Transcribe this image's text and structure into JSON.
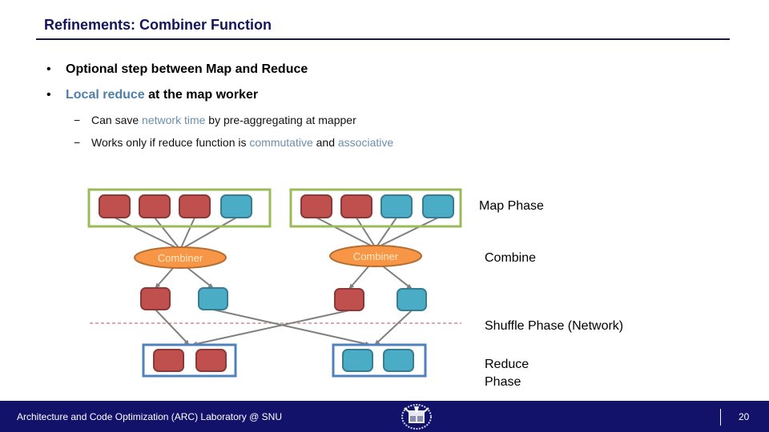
{
  "slide": {
    "title": "Refinements: Combiner Function",
    "bullets": [
      {
        "marker": "•",
        "parts": [
          {
            "text": "Optional  step  between  Map  and  Reduce",
            "highlight": false
          }
        ]
      },
      {
        "marker": "•",
        "parts": [
          {
            "text": "Local reduce",
            "highlight": true
          },
          {
            "text": " at the map worker",
            "highlight": false
          }
        ]
      }
    ],
    "sub_bullets": [
      {
        "marker": "−",
        "before": "Can save ",
        "highlight": "network time",
        "after": " by pre-aggregating at mapper"
      },
      {
        "marker": "−",
        "before": "Works only if reduce function is ",
        "highlight": "commutative",
        "middle": " and ",
        "highlight2": "associative"
      }
    ]
  },
  "diagram": {
    "colors": {
      "red_fill": "#c0504d",
      "red_stroke": "#8c3836",
      "blue_fill": "#4bacc6",
      "blue_stroke": "#357d91",
      "map_box_stroke": "#9bbb59",
      "reduce_box_stroke": "#4f81bd",
      "combiner_fill": "#f79646",
      "combiner_stroke": "#b66d31",
      "arrow": "#808080",
      "network_line": "#c0504d"
    },
    "map_workers": [
      {
        "records": [
          "red",
          "red",
          "red",
          "blue"
        ]
      },
      {
        "records": [
          "red",
          "red",
          "blue",
          "blue"
        ]
      }
    ],
    "combiners": [
      {
        "label": "Combiner",
        "outputs": [
          "red",
          "blue"
        ]
      },
      {
        "label": "Combiner",
        "outputs": [
          "red",
          "blue"
        ]
      }
    ],
    "reducers": [
      {
        "records": [
          "red",
          "red"
        ]
      },
      {
        "records": [
          "blue",
          "blue"
        ]
      }
    ],
    "phase_labels": {
      "map": "Map  Phase",
      "combine": "Combine",
      "shuffle": "Shuffle  Phase  (Network)",
      "reduce_line1": "Reduce",
      "reduce_line2": "Phase"
    }
  },
  "footer": {
    "lab": "Architecture and Code Optimization (ARC) Laboratory @ SNU",
    "logo": "snu-emblem-icon",
    "page": "20"
  }
}
